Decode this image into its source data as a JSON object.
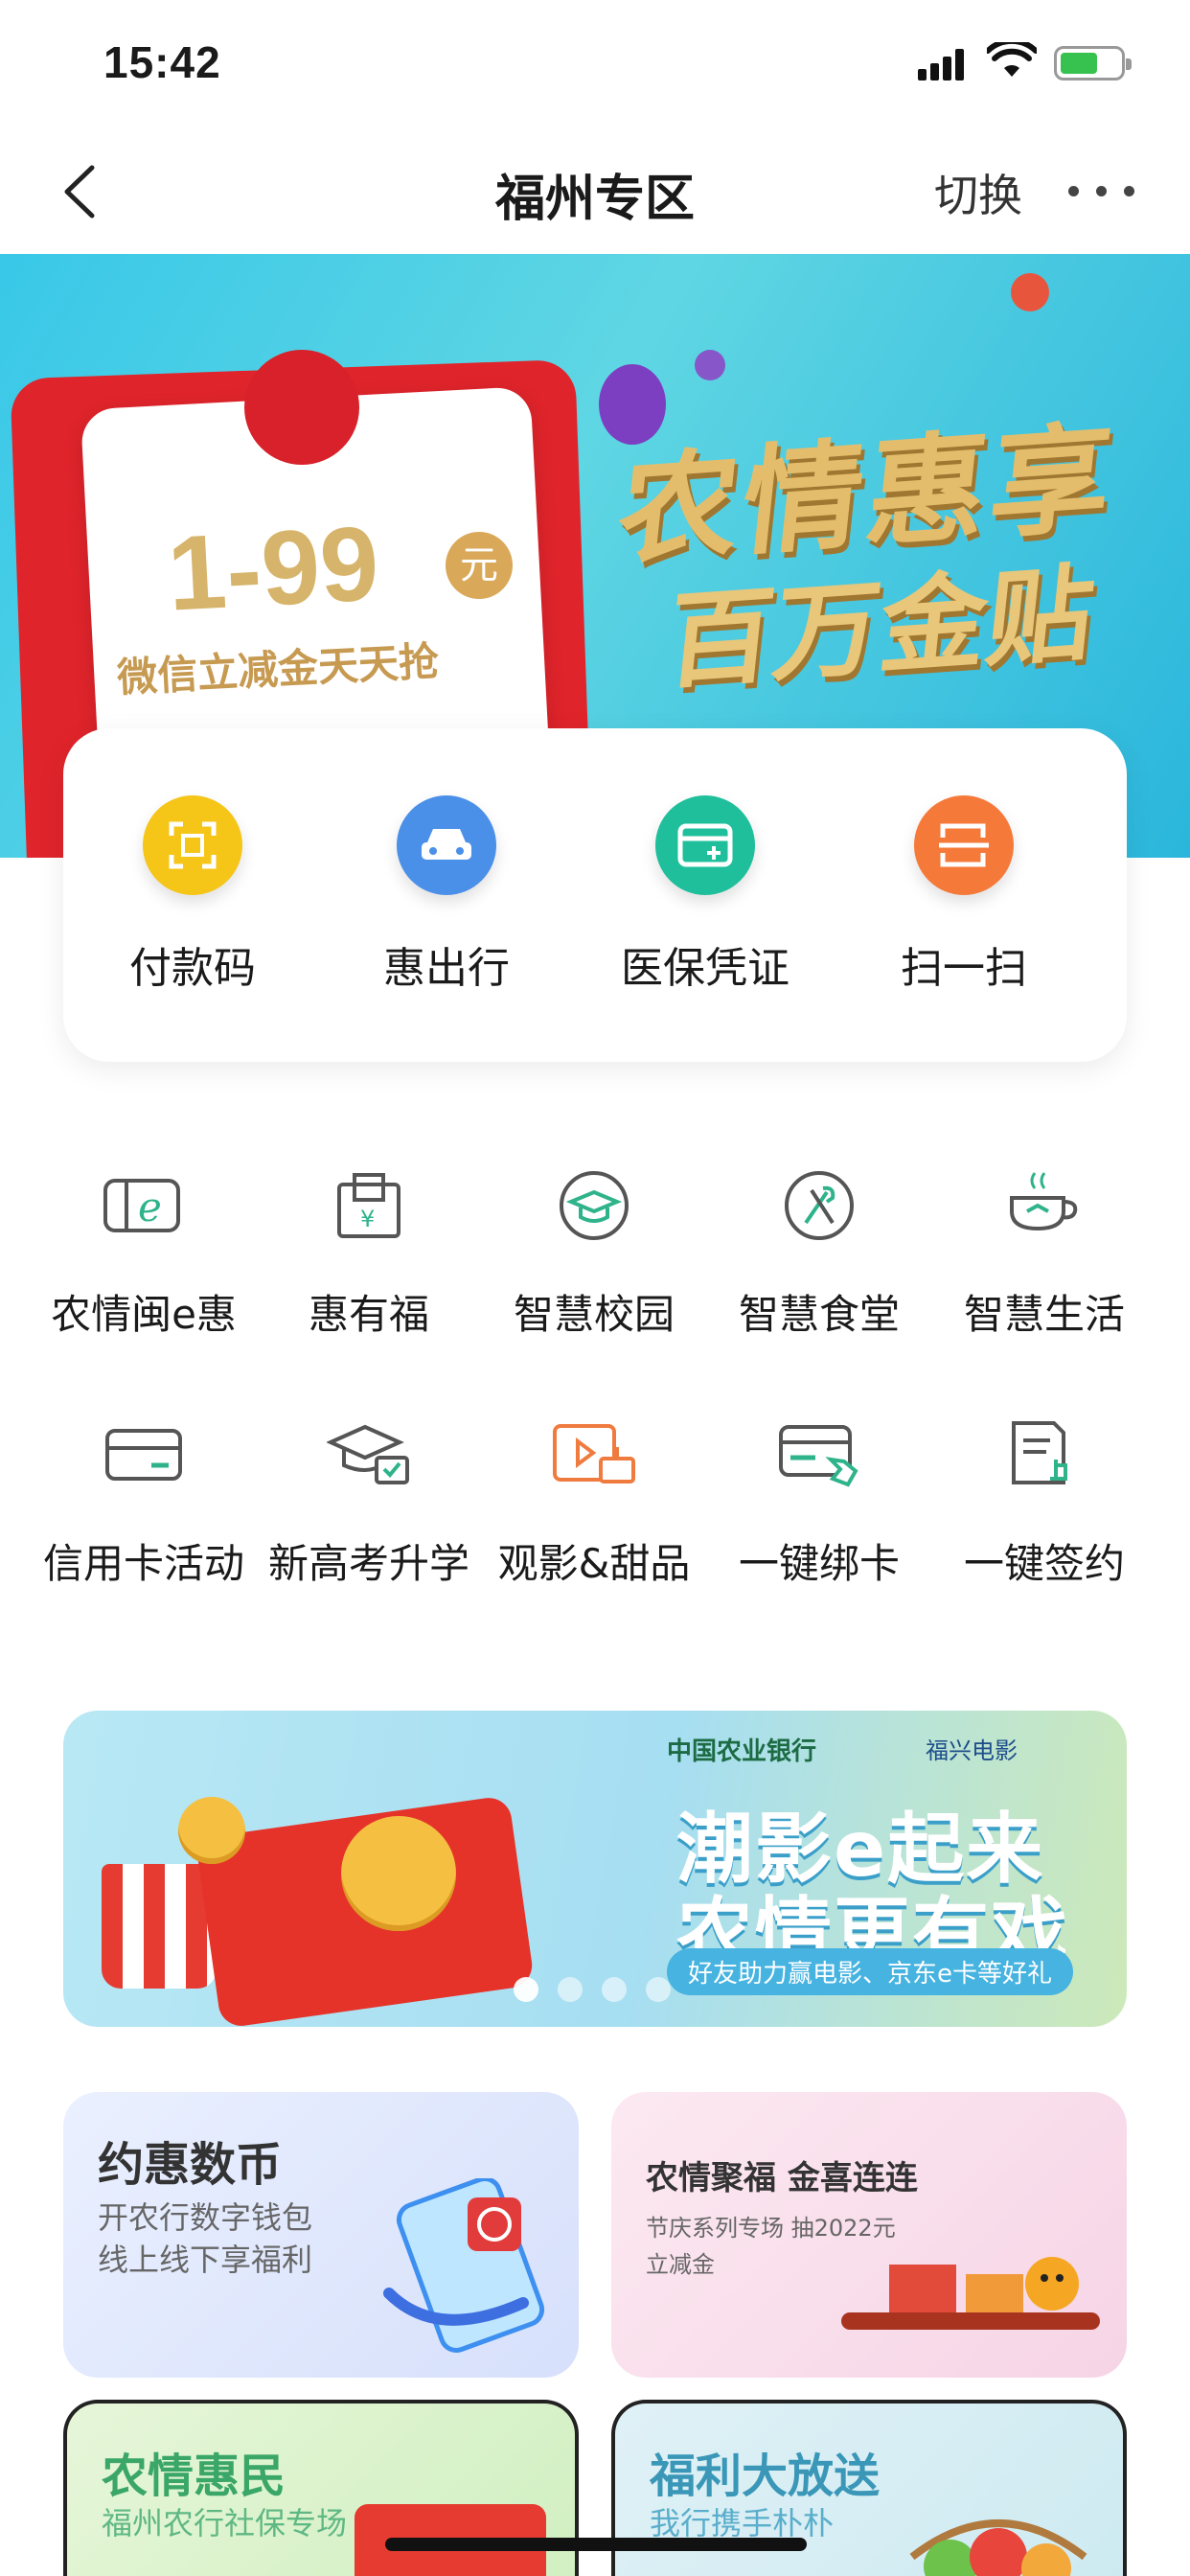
{
  "status_bar": {
    "time": "15:42"
  },
  "nav": {
    "title": "福州专区",
    "switch_label": "切换"
  },
  "hero": {
    "amount": "1-99",
    "currency": "元",
    "subtitle": "微信立减金天天抢",
    "slogan_line1": "农情惠享",
    "slogan_line2": "百万金贴"
  },
  "quick_actions": [
    {
      "label": "付款码",
      "icon": "payment-code-icon",
      "color": "#f5c518"
    },
    {
      "label": "惠出行",
      "icon": "car-icon",
      "color": "#4a90e8"
    },
    {
      "label": "医保凭证",
      "icon": "medical-card-icon",
      "color": "#1fbf9b"
    },
    {
      "label": "扫一扫",
      "icon": "scan-icon",
      "color": "#f57a3a"
    }
  ],
  "services": [
    {
      "label": "农情闽e惠",
      "icon": "e-card-icon"
    },
    {
      "label": "惠有福",
      "icon": "red-packet-icon"
    },
    {
      "label": "智慧校园",
      "icon": "graduation-cap-icon"
    },
    {
      "label": "智慧食堂",
      "icon": "fork-knife-icon"
    },
    {
      "label": "智慧生活",
      "icon": "coffee-cup-icon"
    },
    {
      "label": "信用卡活动",
      "icon": "credit-card-icon"
    },
    {
      "label": "新高考升学",
      "icon": "mortarboard-icon"
    },
    {
      "label": "观影&甜品",
      "icon": "movie-cake-icon"
    },
    {
      "label": "一键绑卡",
      "icon": "bind-card-icon"
    },
    {
      "label": "一键签约",
      "icon": "sign-document-icon"
    }
  ],
  "promo_banner": {
    "bank_name": "中国农业银行",
    "partner": "福兴电影",
    "title_line1": "潮影e起来",
    "title_line2": "农情更有戏",
    "tagline": "好友助力赢电影、京东e卡等好礼",
    "page_count": 4,
    "active_page": 1
  },
  "feature_cards": {
    "digital_coin": {
      "title": "约惠数币",
      "line1": "开农行数字钱包",
      "line2": "线上线下享福利"
    },
    "fortune": {
      "title": "农情聚福 金喜连连",
      "line1": "节庆系列专场 抽2022元",
      "line2": "立减金"
    },
    "social": {
      "title": "农情惠民",
      "line1": "福州农行社保专场"
    },
    "gift": {
      "title": "福利大放送",
      "line1": "我行携手朴朴"
    }
  },
  "colors": {
    "accent_green": "#1fa37a",
    "icon_green": "#2fb38a",
    "icon_gray": "#555555"
  }
}
